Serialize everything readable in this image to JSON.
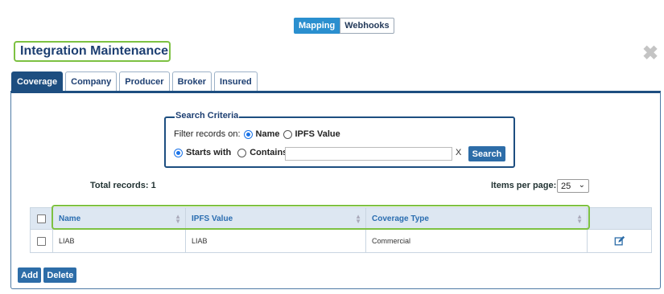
{
  "top_toggle": {
    "mapping": "Mapping",
    "webhooks": "Webhooks"
  },
  "page_title": "Integration Maintenance",
  "close_glyph": "✖",
  "tabs": [
    {
      "label": "Coverage",
      "active": true
    },
    {
      "label": "Company"
    },
    {
      "label": "Producer"
    },
    {
      "label": "Broker"
    },
    {
      "label": "Insured"
    }
  ],
  "search": {
    "legend": "Search Criteria",
    "filter_label": "Filter records on:",
    "filter_name": "Name",
    "filter_ipfs": "IPFS Value",
    "starts_with": "Starts with",
    "contains": "Contains",
    "input_value": "",
    "clear": "X",
    "button": "Search"
  },
  "total_records": "Total records: 1",
  "items_per_page": {
    "label": "Items per page:",
    "value": "25"
  },
  "grid": {
    "columns": [
      "Name",
      "IPFS Value",
      "Coverage Type"
    ],
    "rows": [
      {
        "name": "LIAB",
        "ipfs": "LIAB",
        "type": "Commercial"
      }
    ]
  },
  "actions": {
    "add": "Add",
    "delete": "Delete"
  },
  "colors": {
    "accent": "#2a8fcf",
    "primary": "#1d4e80",
    "highlight": "#7dc142"
  },
  "icons": {
    "close": "close-icon",
    "edit": "edit-icon",
    "sort": "sort-icon",
    "chevron": "chevron-down-icon"
  }
}
